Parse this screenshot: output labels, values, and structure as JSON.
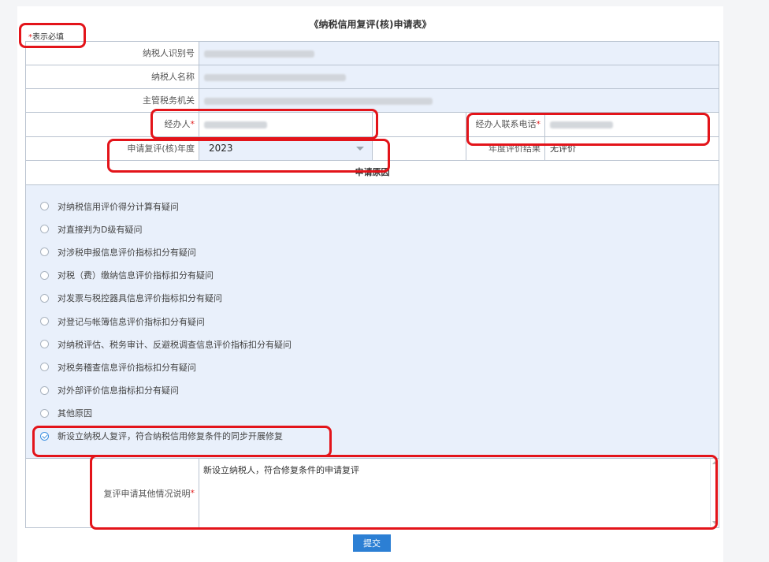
{
  "page": {
    "title": "《纳税信用复评(核)申请表》",
    "required_note": "表示必填",
    "required_mark": "*"
  },
  "form": {
    "taxpayer_id_label": "纳税人识别号",
    "taxpayer_name_label": "纳税人名称",
    "tax_authority_label": "主管税务机关",
    "agent_label": "经办人",
    "agent_phone_label": "经办人联系电话",
    "review_year_label": "申请复评(核)年度",
    "review_year_value": "2023",
    "annual_result_label": "年度评价结果",
    "annual_result_value": "无评价"
  },
  "reasons": {
    "header": "申请原因",
    "options": [
      {
        "label": "对纳税信用评价得分计算有疑问",
        "checked": false
      },
      {
        "label": "对直接判为D级有疑问",
        "checked": false
      },
      {
        "label": "对涉税申报信息评价指标扣分有疑问",
        "checked": false
      },
      {
        "label": "对税（费）缴纳信息评价指标扣分有疑问",
        "checked": false
      },
      {
        "label": "对发票与税控器具信息评价指标扣分有疑问",
        "checked": false
      },
      {
        "label": "对登记与帐簿信息评价指标扣分有疑问",
        "checked": false
      },
      {
        "label": "对纳税评估、税务审计、反避税调查信息评价指标扣分有疑问",
        "checked": false
      },
      {
        "label": "对税务稽查信息评价指标扣分有疑问",
        "checked": false
      },
      {
        "label": "对外部评价信息指标扣分有疑问",
        "checked": false
      },
      {
        "label": "其他原因",
        "checked": false
      },
      {
        "label": "新设立纳税人复评，符合纳税信用修复条件的同步开展修复",
        "checked": true
      }
    ]
  },
  "note": {
    "label": "复评申请其他情况说明",
    "value": "新设立纳税人，符合修复条件的申请复评"
  },
  "submit_label": "提交"
}
